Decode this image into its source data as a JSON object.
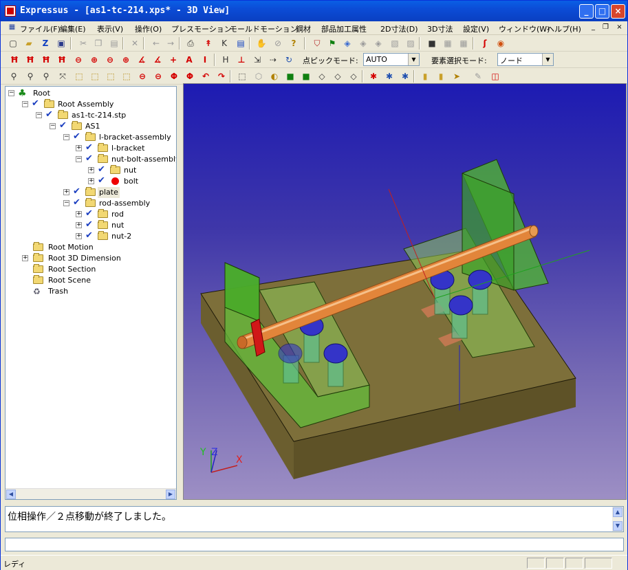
{
  "window": {
    "title": "Expressus - [as1-tc-214.xps* - 3D View]",
    "minimize": "_",
    "maximize": "□",
    "close": "×"
  },
  "menubar": {
    "items": [
      "ファイル(F)",
      "編集(E)",
      "表示(V)",
      "操作(O)",
      "プレスモーション",
      "モールドモーション",
      "鋼材",
      "部品加工属性",
      "2D寸法(D)",
      "3D寸法",
      "設定(V)",
      "ウィンドウ(W)",
      "ヘルプ(H)"
    ],
    "mdi": [
      "_",
      "❐",
      "×"
    ]
  },
  "toolbar1": {
    "icons": [
      "new-icon",
      "open-icon",
      "z-icon",
      "save-icon",
      "cut-icon",
      "copy-icon",
      "paste-icon",
      "delete-icon",
      "undo-icon",
      "redo-icon",
      "print-icon",
      "pointer-icon",
      "k-icon",
      "properties-icon",
      "hand-icon",
      "disabled-icon",
      "help-icon",
      "shield-icon",
      "flag-icon",
      "cube-icon",
      "cube2-icon",
      "cube3-icon",
      "image-icon",
      "image2-icon",
      "camera-icon",
      "image3-icon",
      "image4-icon",
      "s-curve-icon",
      "colorwheel-icon"
    ]
  },
  "toolbar2": {
    "pick_mode_label": "点ピックモード:",
    "pick_mode_value": "AUTO",
    "select_mode_label": "要素選択モード:",
    "select_mode_value": "ノード"
  },
  "tree": {
    "rows": [
      {
        "label": "Root"
      },
      {
        "label": "Root Assembly"
      },
      {
        "label": "as1-tc-214.stp"
      },
      {
        "label": "AS1"
      },
      {
        "label": "l-bracket-assembly"
      },
      {
        "label": "l-bracket"
      },
      {
        "label": "nut-bolt-assembly"
      },
      {
        "label": "nut"
      },
      {
        "label": "bolt"
      },
      {
        "label": "plate"
      },
      {
        "label": "rod-assembly"
      },
      {
        "label": "rod"
      },
      {
        "label": "nut"
      },
      {
        "label": "nut-2"
      },
      {
        "label": "Root Motion"
      },
      {
        "label": "Root 3D Dimension"
      },
      {
        "label": "Root Section"
      },
      {
        "label": "Root Scene"
      },
      {
        "label": "Trash"
      }
    ]
  },
  "viewport": {
    "axis_y": "Y",
    "axis_z": "Z",
    "axis_x": "X"
  },
  "output": {
    "message": "位相操作／２点移動が終了しました。"
  },
  "statusbar": {
    "text": "レディ"
  }
}
